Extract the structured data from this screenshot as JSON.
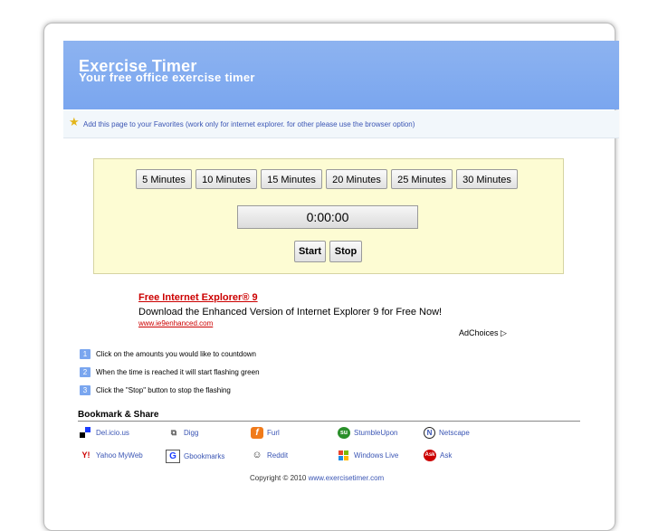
{
  "header": {
    "title": "Exercise Timer",
    "subtitle": "Your free office exercise timer"
  },
  "favorites": {
    "text": "Add this page to your Favorites (work only for internet explorer. for other please use the browser option)"
  },
  "timer": {
    "presets": [
      "5 Minutes",
      "10 Minutes",
      "15 Minutes",
      "20 Minutes",
      "25 Minutes",
      "30 Minutes"
    ],
    "display": "0:00:00",
    "start_label": "Start",
    "stop_label": "Stop"
  },
  "ad": {
    "title": "Free Internet Explorer® 9",
    "body": "Download the Enhanced Version of Internet Explorer 9 for Free Now!",
    "url": "www.ie9enhanced.com",
    "adchoices": "AdChoices"
  },
  "steps": [
    {
      "num": "1",
      "text": "Click on the amounts you would like to countdown"
    },
    {
      "num": "2",
      "text": "When the time is reached it will start flashing green"
    },
    {
      "num": "3",
      "text": "Click the \"Stop\" button to stop the flashing"
    }
  ],
  "bookmarks": {
    "title": "Bookmark & Share",
    "items": [
      {
        "label": "Del.icio.us",
        "icon": "delicious-icon"
      },
      {
        "label": "Digg",
        "icon": "digg-icon"
      },
      {
        "label": "Furl",
        "icon": "furl-icon"
      },
      {
        "label": "StumbleUpon",
        "icon": "stumbleupon-icon"
      },
      {
        "label": "Netscape",
        "icon": "netscape-icon"
      },
      {
        "label": "Yahoo MyWeb",
        "icon": "yahoo-icon"
      },
      {
        "label": "Gbookmarks",
        "icon": "google-icon"
      },
      {
        "label": "Reddit",
        "icon": "reddit-icon"
      },
      {
        "label": "Windows Live",
        "icon": "windows-live-icon"
      },
      {
        "label": "Ask",
        "icon": "ask-icon"
      }
    ]
  },
  "footer": {
    "copyright": "Copyright © 2010",
    "link": "www.exercisetimer.com"
  },
  "colors": {
    "header_blue": "#7aa6ef",
    "timer_bg": "#fdfcd3",
    "link_blue": "#3a55b4",
    "ad_red": "#cc0000"
  }
}
